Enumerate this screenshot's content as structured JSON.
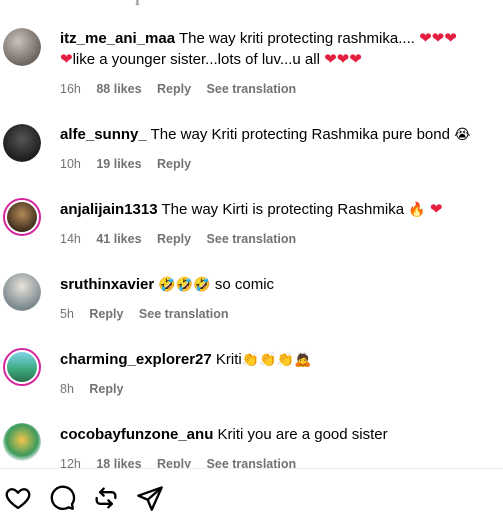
{
  "top_fragment": "ℹ",
  "comments": [
    {
      "username": "itz_me_ani_maa",
      "text_a": "The way kriti protecting rashmika....",
      "text_b": "like a younger sister...lots of luv...u all",
      "time": "16h",
      "likes": "88 likes",
      "reply": "Reply",
      "translate": "See translation"
    },
    {
      "username": "alfe_sunny_",
      "text": "The way Kriti protecting Rashmika pure bond",
      "time": "10h",
      "likes": "19 likes",
      "reply": "Reply"
    },
    {
      "username": "anjalijain1313",
      "text": "The way Kirti is protecting Rashmika",
      "time": "14h",
      "likes": "41 likes",
      "reply": "Reply",
      "translate": "See translation"
    },
    {
      "username": "sruthinxavier",
      "text": "so comic",
      "time": "5h",
      "reply": "Reply",
      "translate": "See translation"
    },
    {
      "username": "charming_explorer27",
      "text": "Kriti",
      "time": "8h",
      "reply": "Reply"
    },
    {
      "username": "cocobayfunzone_anu",
      "text": "Kriti you are a good sister",
      "time": "12h",
      "likes": "18 likes",
      "reply": "Reply",
      "translate": "See translation"
    }
  ],
  "actions": {
    "like": "heart-icon",
    "comment": "comment-icon",
    "repost": "repost-icon",
    "share": "send-icon"
  },
  "colors": {
    "heart": "#e41e3f",
    "meta": "#737373",
    "story_ring": "#d6249f"
  }
}
